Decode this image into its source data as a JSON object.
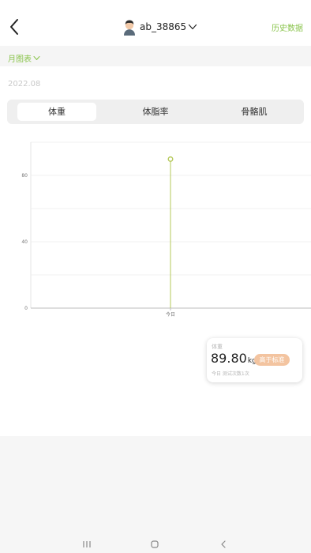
{
  "header": {
    "username": "ab_38865",
    "history_label": "历史数据"
  },
  "month_selector": {
    "label": "月图表"
  },
  "date": "2022.08",
  "tabs": [
    {
      "label": "体重",
      "active": true
    },
    {
      "label": "体脂率",
      "active": false
    },
    {
      "label": "骨骼肌",
      "active": false
    }
  ],
  "chart_data": {
    "type": "line",
    "categories": [
      "今日"
    ],
    "series": [
      {
        "values": [
          89.8
        ]
      }
    ],
    "y_tick_labels": [
      "80",
      "40",
      "0"
    ],
    "ylim": [
      0,
      100
    ],
    "color": "#b5c95a",
    "grid": true
  },
  "summary_card": {
    "title": "体重",
    "value": "89.80",
    "unit": "kg",
    "badge": "高于标准",
    "sub": "今日 测试次数1次"
  },
  "colors": {
    "accent": "#8ac44c",
    "badge": "#f3c4a0",
    "chart_line": "#b5c95a"
  }
}
